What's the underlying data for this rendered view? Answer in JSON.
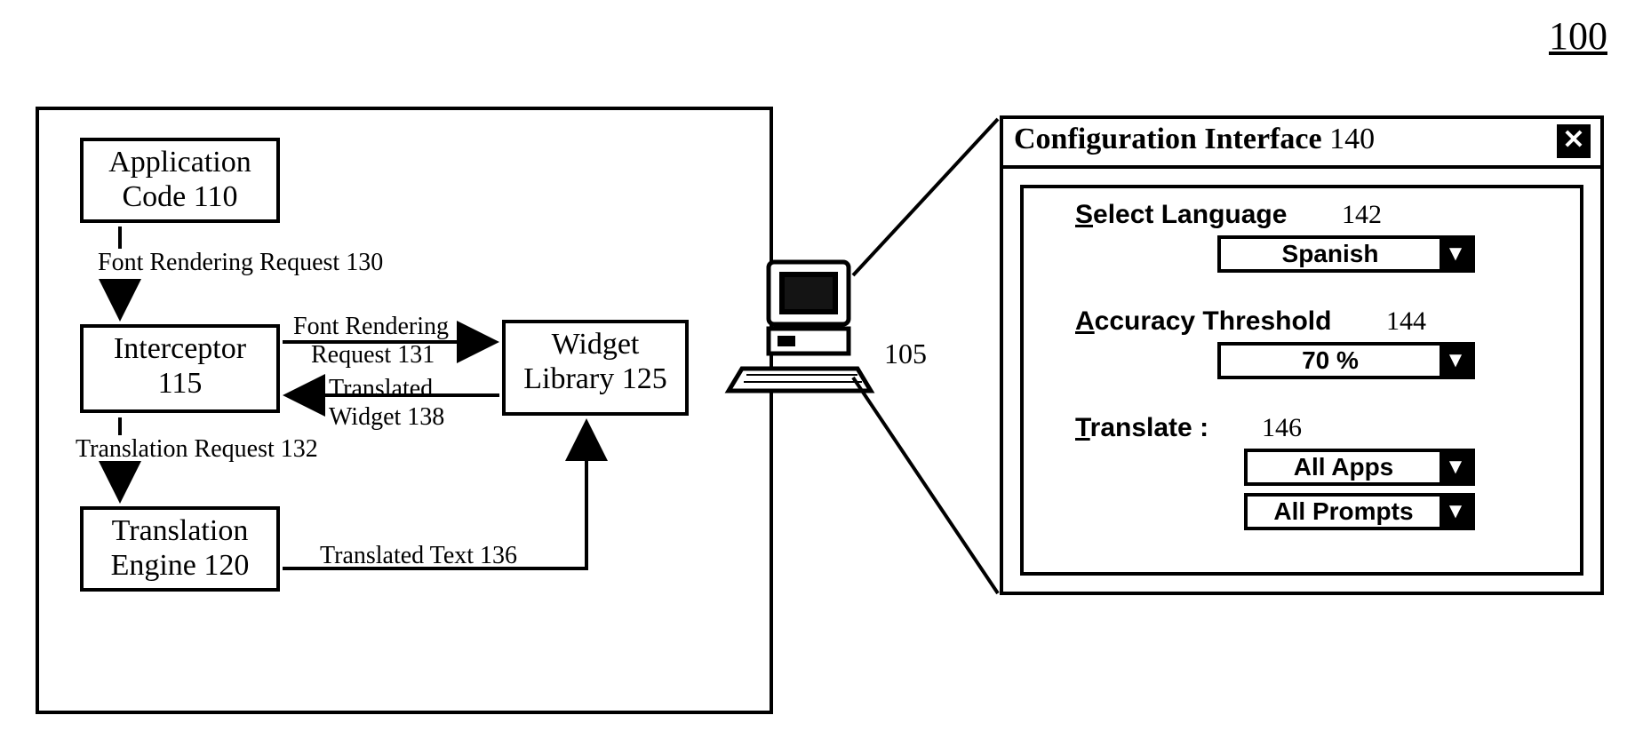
{
  "figure_ref": "100",
  "computer_ref": "105",
  "blocks": {
    "app_code": {
      "l1": "Application",
      "l2": "Code 110"
    },
    "interceptor": {
      "l1": "Interceptor",
      "l2": "115"
    },
    "translation_engine": {
      "l1": "Translation",
      "l2": "Engine 120"
    },
    "widget_library": {
      "l1": "Widget",
      "l2": "Library 125"
    }
  },
  "labels": {
    "font_req_130": "Font Rendering Request 130",
    "font_req_131_a": "Font Rendering",
    "font_req_131_b": "Request 131",
    "translated_widget_a": "Translated",
    "translated_widget_b": "Widget 138",
    "translation_req_132": "Translation Request 132",
    "translated_text_136": "Translated Text 136"
  },
  "config": {
    "title_prefix": "Configuration Interface",
    "title_ref": "140",
    "close_glyph": "✕",
    "select_language": {
      "label_u": "S",
      "label_rest": "elect Language",
      "ref": "142",
      "value": "Spanish"
    },
    "accuracy": {
      "label_u": "A",
      "label_rest": "ccuracy Threshold",
      "ref": "144",
      "value": "70 %"
    },
    "translate": {
      "label_u": "T",
      "label_rest": "ranslate :",
      "ref": "146",
      "value1": "All Apps",
      "value2": "All Prompts"
    }
  }
}
